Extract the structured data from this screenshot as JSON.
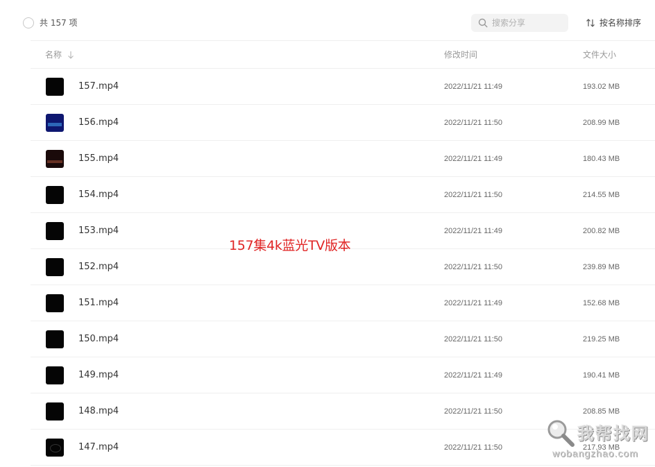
{
  "toolbar": {
    "count_label": "共 157 项",
    "search_placeholder": "搜索分享",
    "sort_label": "按名称排序"
  },
  "table": {
    "columns": {
      "name": "名称",
      "modified": "修改时间",
      "size": "文件大小"
    },
    "rows": [
      {
        "name": "157.mp4",
        "modified": "2022/11/21 11:49",
        "size": "193.02 MB",
        "thumb": "black"
      },
      {
        "name": "156.mp4",
        "modified": "2022/11/21 11:50",
        "size": "208.99 MB",
        "thumb": "blue"
      },
      {
        "name": "155.mp4",
        "modified": "2022/11/21 11:49",
        "size": "180.43 MB",
        "thumb": "dark-red"
      },
      {
        "name": "154.mp4",
        "modified": "2022/11/21 11:50",
        "size": "214.55 MB",
        "thumb": "black"
      },
      {
        "name": "153.mp4",
        "modified": "2022/11/21 11:49",
        "size": "200.82 MB",
        "thumb": "black"
      },
      {
        "name": "152.mp4",
        "modified": "2022/11/21 11:50",
        "size": "239.89 MB",
        "thumb": "black"
      },
      {
        "name": "151.mp4",
        "modified": "2022/11/21 11:49",
        "size": "152.68 MB",
        "thumb": "black"
      },
      {
        "name": "150.mp4",
        "modified": "2022/11/21 11:50",
        "size": "219.25 MB",
        "thumb": "black"
      },
      {
        "name": "149.mp4",
        "modified": "2022/11/21 11:49",
        "size": "190.41 MB",
        "thumb": "black"
      },
      {
        "name": "148.mp4",
        "modified": "2022/11/21 11:50",
        "size": "208.85 MB",
        "thumb": "black"
      },
      {
        "name": "147.mp4",
        "modified": "2022/11/21 11:50",
        "size": "217.93 MB",
        "thumb": "logo"
      }
    ]
  },
  "overlay": {
    "caption": "157集4k蓝光TV版本"
  },
  "watermark": {
    "title": "我帮找网",
    "url": "wobangzhao.com"
  },
  "colors": {
    "caption": "#e02424",
    "divider": "#efefef",
    "muted_text": "#999999"
  },
  "icons": {
    "search": "search-icon",
    "sort": "sort-icon",
    "sort_arrow": "arrow-down-icon"
  }
}
